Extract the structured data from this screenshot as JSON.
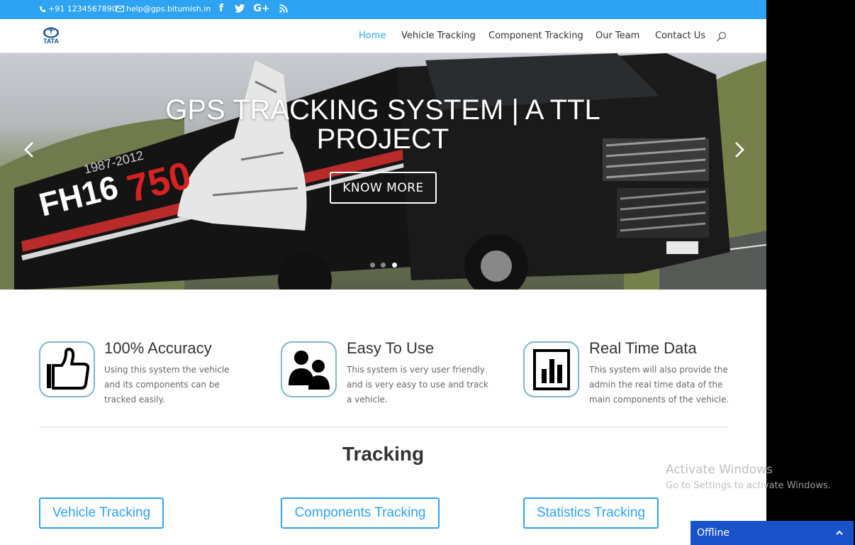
{
  "topbar": {
    "phone": "+91 1234567890",
    "email": "help@gps.bitumish.in",
    "social": [
      "facebook-icon",
      "twitter-icon",
      "google-plus-icon",
      "rss-icon"
    ]
  },
  "header": {
    "logo_text": "TATA",
    "nav": [
      "Home",
      "Vehicle Tracking",
      "Component Tracking",
      "Our Team",
      "Contact Us"
    ],
    "active_nav": "Home"
  },
  "hero": {
    "title": "GPS TRACKING SYSTEM | A TTL PROJECT",
    "button_label": "KNOW MORE",
    "slides": 3,
    "active_slide": 3
  },
  "blurbs": [
    {
      "title": "100% Accuracy",
      "text": "Using this system the vehicle and its components can be tracked easily.",
      "icon": "thumbs-up-icon"
    },
    {
      "title": "Easy To Use",
      "text": "This system is very user friendly and is very easy to use and track a vehicle.",
      "icon": "users-icon"
    },
    {
      "title": "Real Time Data",
      "text": "This system will also provide the admin the real time data of the main components of the vehicle.",
      "icon": "bar-chart-icon"
    }
  ],
  "tracking": {
    "title": "Tracking",
    "buttons": [
      "Vehicle Tracking",
      "Components Tracking",
      "Statistics Tracking"
    ]
  },
  "watermark": {
    "line1": "Activate Windows",
    "line2": "Go to Settings to activate Windows."
  },
  "chat": {
    "status": "Offline"
  },
  "colors": {
    "accent": "#2ea3f2",
    "chat_bar": "#1a53c9"
  }
}
